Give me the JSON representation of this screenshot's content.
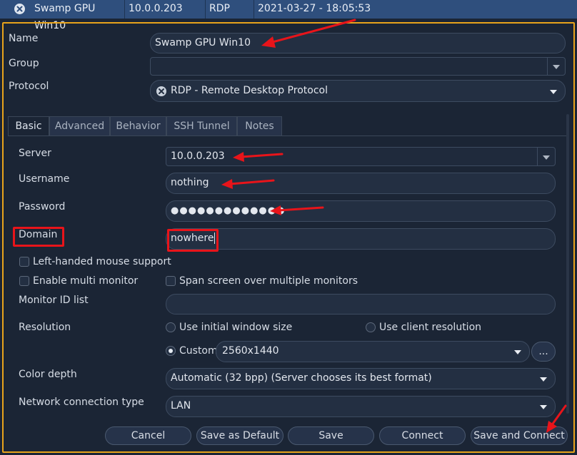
{
  "connection_row": {
    "name": "Swamp GPU Win10",
    "server": "10.0.0.203",
    "protocol": "RDP",
    "date": "2021-03-27 - 18:05:53"
  },
  "profile": {
    "name_label": "Name",
    "name_value": "Swamp GPU Win10",
    "group_label": "Group",
    "group_value": "",
    "protocol_label": "Protocol",
    "protocol_value": "RDP - Remote Desktop Protocol"
  },
  "tabs": [
    {
      "label": "Basic",
      "active": true
    },
    {
      "label": "Advanced",
      "active": false
    },
    {
      "label": "Behavior",
      "active": false
    },
    {
      "label": "SSH Tunnel",
      "active": false
    },
    {
      "label": "Notes",
      "active": false
    }
  ],
  "basic": {
    "server_label": "Server",
    "server_value": "10.0.0.203",
    "username_label": "Username",
    "username_value": "nothing",
    "password_label": "Password",
    "password_value": "●●●●●●●●●●●●●",
    "domain_label": "Domain",
    "domain_value": "nowhere",
    "left_handed_label": "Left-handed mouse support",
    "multi_monitor_label": "Enable multi monitor",
    "span_screen_label": "Span screen over multiple monitors",
    "monitor_id_label": "Monitor ID list",
    "monitor_id_value": "",
    "resolution_label": "Resolution",
    "res_initial_label": "Use initial window size",
    "res_client_label": "Use client resolution",
    "res_custom_label": "Custom",
    "res_custom_value": "2560x1440",
    "res_more_label": "...",
    "color_depth_label": "Color depth",
    "color_depth_value": "Automatic (32 bpp) (Server chooses its best format)",
    "network_label": "Network connection type",
    "network_value": "LAN"
  },
  "buttons": {
    "cancel": "Cancel",
    "save_default": "Save as Default",
    "save": "Save",
    "connect": "Connect",
    "save_connect": "Save and Connect"
  },
  "colors": {
    "frame_border": "#e8a31b",
    "annotation_red": "#e8141a",
    "header_bg": "#2f4f7d",
    "window_bg": "#1b2535"
  },
  "icons": {
    "protocol": "rdp-protocol-icon"
  }
}
